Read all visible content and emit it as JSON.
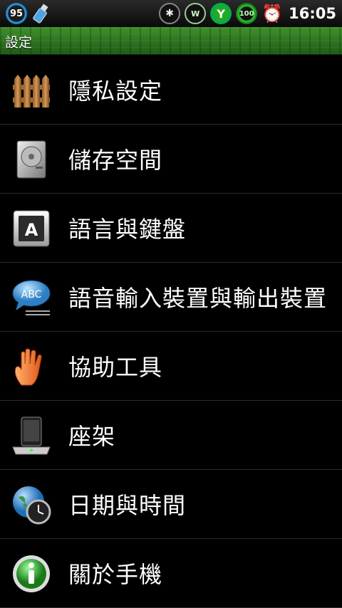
{
  "status_bar": {
    "battery_level_badge": "95",
    "battery_percent_badge": "100",
    "time": "16:05",
    "icons": [
      "battery-ring-icon",
      "usb-icon",
      "bluetooth-icon",
      "wifi-icon",
      "signal-icon",
      "battery-100-icon",
      "alarm-icon"
    ]
  },
  "header": {
    "title": "設定"
  },
  "settings": {
    "items": [
      {
        "label": "隱私設定",
        "icon": "fence-privacy-icon"
      },
      {
        "label": "儲存空間",
        "icon": "hard-disk-icon"
      },
      {
        "label": "語言與鍵盤",
        "icon": "letter-a-key-icon"
      },
      {
        "label": "語音輸入裝置與輸出裝置",
        "icon": "abc-speech-bubble-icon"
      },
      {
        "label": "協助工具",
        "icon": "hand-icon"
      },
      {
        "label": "座架",
        "icon": "phone-dock-icon"
      },
      {
        "label": "日期與時間",
        "icon": "globe-clock-icon"
      },
      {
        "label": "關於手機",
        "icon": "info-icon"
      }
    ]
  },
  "colors": {
    "title_bar": "#2f7a23",
    "background": "#000000",
    "divider": "#2a2a2a"
  }
}
